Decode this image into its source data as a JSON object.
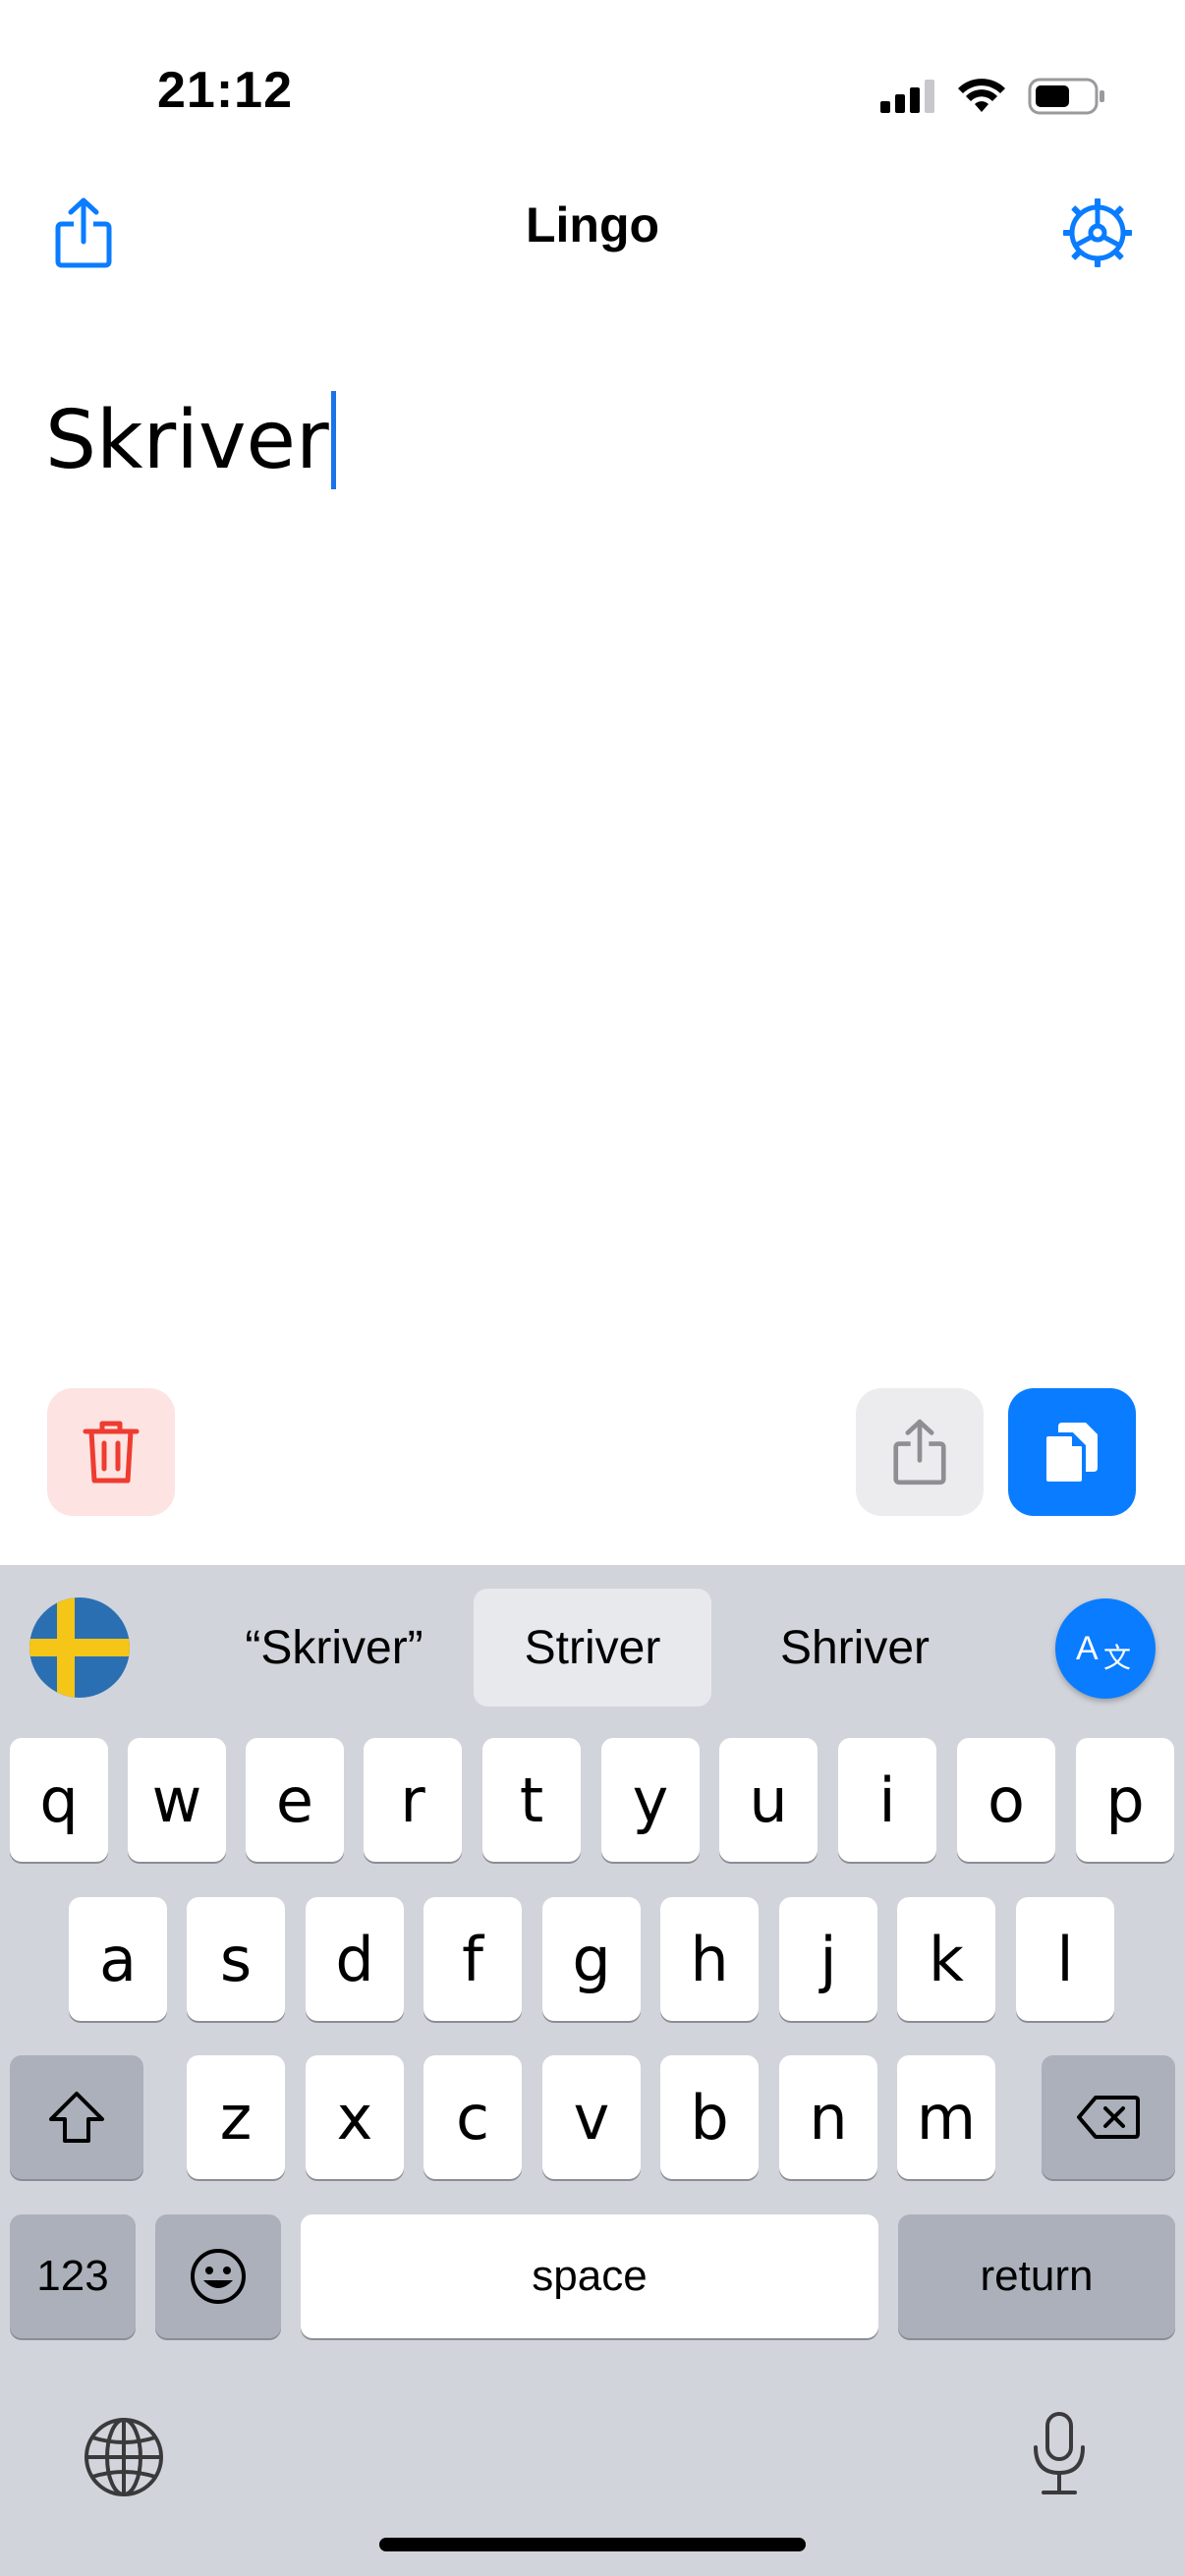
{
  "status_bar": {
    "time": "21:12",
    "icons": [
      "cellular-signal-icon",
      "wifi-icon",
      "battery-icon"
    ]
  },
  "nav": {
    "title": "Lingo",
    "left_icon": "share-icon",
    "right_icon": "settings-gear-icon"
  },
  "editor": {
    "text": "Skriver"
  },
  "actions": {
    "delete_icon": "trash-icon",
    "share_icon": "share-icon",
    "copy_icon": "copy-icon"
  },
  "keyboard": {
    "language_flag": "sweden-flag-icon",
    "suggestions": [
      "“Skriver”",
      "Striver",
      "Shriver"
    ],
    "translate_icon": "translate-icon",
    "row1": [
      "q",
      "w",
      "e",
      "r",
      "t",
      "y",
      "u",
      "i",
      "o",
      "p"
    ],
    "row2": [
      "a",
      "s",
      "d",
      "f",
      "g",
      "h",
      "j",
      "k",
      "l"
    ],
    "row3": [
      "z",
      "x",
      "c",
      "v",
      "b",
      "n",
      "m"
    ],
    "numbers_label": "123",
    "space_label": "space",
    "return_label": "return",
    "globe_icon": "globe-icon",
    "mic_icon": "microphone-icon"
  },
  "colors": {
    "accent": "#0a7cff",
    "delete_bg": "#fde3e1",
    "delete_icon": "#ef3b30",
    "keyboard_bg": "#d1d4da"
  }
}
